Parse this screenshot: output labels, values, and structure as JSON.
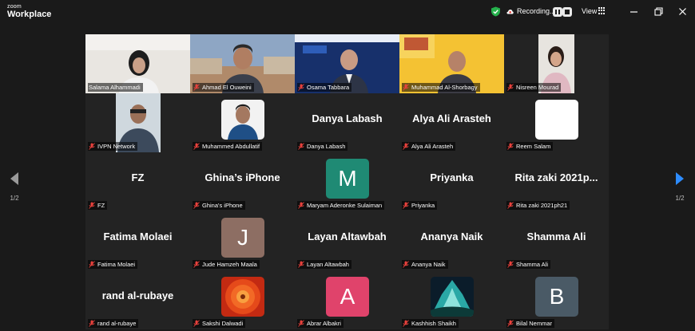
{
  "app": {
    "brand_small": "zoom",
    "brand_name": "Workplace"
  },
  "toolbar": {
    "recording_label": "Recording...",
    "view_label": "View"
  },
  "pagination": {
    "left": "1/2",
    "right": "1/2"
  },
  "colors": {
    "speaking_outline": "#3fcf62",
    "muted_mic": "#e8413c",
    "next_arrow": "#2d8cff"
  },
  "participants": [
    {
      "name": "Salama Alhammadi",
      "kind": "video",
      "speaking": true
    },
    {
      "name": "Ahmad El Ouweini",
      "kind": "video"
    },
    {
      "name": "Osama Tabbara",
      "kind": "video"
    },
    {
      "name": "Muhammad Al-Shorbagy",
      "kind": "video"
    },
    {
      "name": "Nisreen Mourad",
      "kind": "video"
    },
    {
      "name": "IVPN Network",
      "kind": "photo"
    },
    {
      "name": "Muhammed Abdullatif",
      "kind": "photo"
    },
    {
      "name": "Danya Labash",
      "kind": "text",
      "display": "Danya Labash"
    },
    {
      "name": "Alya Ali Arasteh",
      "kind": "text",
      "display": "Alya Ali Arasteh"
    },
    {
      "name": "Reem Salam",
      "kind": "blank"
    },
    {
      "name": "FZ",
      "kind": "text",
      "display": "FZ"
    },
    {
      "name": "Ghina's iPhone",
      "kind": "text",
      "display": "Ghina’s iPhone"
    },
    {
      "name": "Maryam Aderonke Sulaiman",
      "kind": "letter",
      "letter": "M",
      "color": "#1f8a74"
    },
    {
      "name": "Priyanka",
      "kind": "text",
      "display": "Priyanka"
    },
    {
      "name": "Rita zaki 2021ph21",
      "kind": "text",
      "display": "Rita zaki 2021p..."
    },
    {
      "name": "Fatima Molaei",
      "kind": "text",
      "display": "Fatima Molaei"
    },
    {
      "name": "Jude Hamzeh Maala",
      "kind": "letter",
      "letter": "J",
      "color": "#8d6e63"
    },
    {
      "name": "Layan Altawbah",
      "kind": "text",
      "display": "Layan Altawbah"
    },
    {
      "name": "Ananya Naik",
      "kind": "text",
      "display": "Ananya Naik"
    },
    {
      "name": "Shamma Ali",
      "kind": "text",
      "display": "Shamma Ali"
    },
    {
      "name": "rand al-rubaye",
      "kind": "text",
      "display": "rand al-rubaye"
    },
    {
      "name": "Sakshi Dalwadi",
      "kind": "photo"
    },
    {
      "name": "Abrar Albakri",
      "kind": "letter",
      "letter": "A",
      "color": "#e0436b"
    },
    {
      "name": "Kashhish Shaikh",
      "kind": "photo"
    },
    {
      "name": "Bilal Nemmar",
      "kind": "letter",
      "letter": "B",
      "color": "#4a5a66"
    }
  ]
}
